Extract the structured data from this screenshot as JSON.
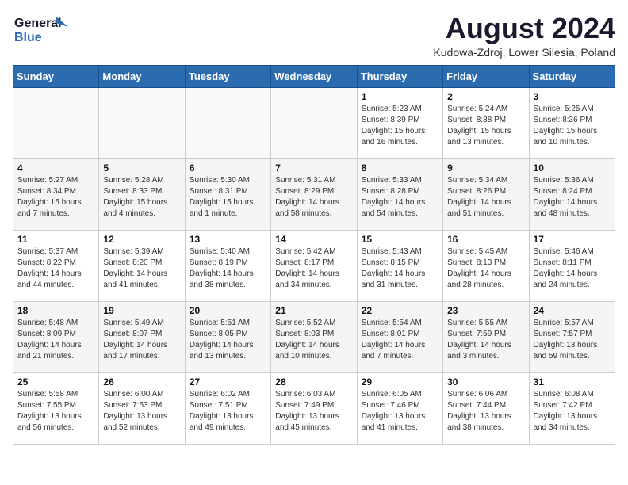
{
  "header": {
    "logo_line1": "General",
    "logo_line2": "Blue",
    "month_year": "August 2024",
    "location": "Kudowa-Zdroj, Lower Silesia, Poland"
  },
  "weekdays": [
    "Sunday",
    "Monday",
    "Tuesday",
    "Wednesday",
    "Thursday",
    "Friday",
    "Saturday"
  ],
  "weeks": [
    [
      {
        "day": "",
        "info": ""
      },
      {
        "day": "",
        "info": ""
      },
      {
        "day": "",
        "info": ""
      },
      {
        "day": "",
        "info": ""
      },
      {
        "day": "1",
        "info": "Sunrise: 5:23 AM\nSunset: 8:39 PM\nDaylight: 15 hours\nand 16 minutes."
      },
      {
        "day": "2",
        "info": "Sunrise: 5:24 AM\nSunset: 8:38 PM\nDaylight: 15 hours\nand 13 minutes."
      },
      {
        "day": "3",
        "info": "Sunrise: 5:25 AM\nSunset: 8:36 PM\nDaylight: 15 hours\nand 10 minutes."
      }
    ],
    [
      {
        "day": "4",
        "info": "Sunrise: 5:27 AM\nSunset: 8:34 PM\nDaylight: 15 hours\nand 7 minutes."
      },
      {
        "day": "5",
        "info": "Sunrise: 5:28 AM\nSunset: 8:33 PM\nDaylight: 15 hours\nand 4 minutes."
      },
      {
        "day": "6",
        "info": "Sunrise: 5:30 AM\nSunset: 8:31 PM\nDaylight: 15 hours\nand 1 minute."
      },
      {
        "day": "7",
        "info": "Sunrise: 5:31 AM\nSunset: 8:29 PM\nDaylight: 14 hours\nand 58 minutes."
      },
      {
        "day": "8",
        "info": "Sunrise: 5:33 AM\nSunset: 8:28 PM\nDaylight: 14 hours\nand 54 minutes."
      },
      {
        "day": "9",
        "info": "Sunrise: 5:34 AM\nSunset: 8:26 PM\nDaylight: 14 hours\nand 51 minutes."
      },
      {
        "day": "10",
        "info": "Sunrise: 5:36 AM\nSunset: 8:24 PM\nDaylight: 14 hours\nand 48 minutes."
      }
    ],
    [
      {
        "day": "11",
        "info": "Sunrise: 5:37 AM\nSunset: 8:22 PM\nDaylight: 14 hours\nand 44 minutes."
      },
      {
        "day": "12",
        "info": "Sunrise: 5:39 AM\nSunset: 8:20 PM\nDaylight: 14 hours\nand 41 minutes."
      },
      {
        "day": "13",
        "info": "Sunrise: 5:40 AM\nSunset: 8:19 PM\nDaylight: 14 hours\nand 38 minutes."
      },
      {
        "day": "14",
        "info": "Sunrise: 5:42 AM\nSunset: 8:17 PM\nDaylight: 14 hours\nand 34 minutes."
      },
      {
        "day": "15",
        "info": "Sunrise: 5:43 AM\nSunset: 8:15 PM\nDaylight: 14 hours\nand 31 minutes."
      },
      {
        "day": "16",
        "info": "Sunrise: 5:45 AM\nSunset: 8:13 PM\nDaylight: 14 hours\nand 28 minutes."
      },
      {
        "day": "17",
        "info": "Sunrise: 5:46 AM\nSunset: 8:11 PM\nDaylight: 14 hours\nand 24 minutes."
      }
    ],
    [
      {
        "day": "18",
        "info": "Sunrise: 5:48 AM\nSunset: 8:09 PM\nDaylight: 14 hours\nand 21 minutes."
      },
      {
        "day": "19",
        "info": "Sunrise: 5:49 AM\nSunset: 8:07 PM\nDaylight: 14 hours\nand 17 minutes."
      },
      {
        "day": "20",
        "info": "Sunrise: 5:51 AM\nSunset: 8:05 PM\nDaylight: 14 hours\nand 13 minutes."
      },
      {
        "day": "21",
        "info": "Sunrise: 5:52 AM\nSunset: 8:03 PM\nDaylight: 14 hours\nand 10 minutes."
      },
      {
        "day": "22",
        "info": "Sunrise: 5:54 AM\nSunset: 8:01 PM\nDaylight: 14 hours\nand 7 minutes."
      },
      {
        "day": "23",
        "info": "Sunrise: 5:55 AM\nSunset: 7:59 PM\nDaylight: 14 hours\nand 3 minutes."
      },
      {
        "day": "24",
        "info": "Sunrise: 5:57 AM\nSunset: 7:57 PM\nDaylight: 13 hours\nand 59 minutes."
      }
    ],
    [
      {
        "day": "25",
        "info": "Sunrise: 5:58 AM\nSunset: 7:55 PM\nDaylight: 13 hours\nand 56 minutes."
      },
      {
        "day": "26",
        "info": "Sunrise: 6:00 AM\nSunset: 7:53 PM\nDaylight: 13 hours\nand 52 minutes."
      },
      {
        "day": "27",
        "info": "Sunrise: 6:02 AM\nSunset: 7:51 PM\nDaylight: 13 hours\nand 49 minutes."
      },
      {
        "day": "28",
        "info": "Sunrise: 6:03 AM\nSunset: 7:49 PM\nDaylight: 13 hours\nand 45 minutes."
      },
      {
        "day": "29",
        "info": "Sunrise: 6:05 AM\nSunset: 7:46 PM\nDaylight: 13 hours\nand 41 minutes."
      },
      {
        "day": "30",
        "info": "Sunrise: 6:06 AM\nSunset: 7:44 PM\nDaylight: 13 hours\nand 38 minutes."
      },
      {
        "day": "31",
        "info": "Sunrise: 6:08 AM\nSunset: 7:42 PM\nDaylight: 13 hours\nand 34 minutes."
      }
    ]
  ]
}
